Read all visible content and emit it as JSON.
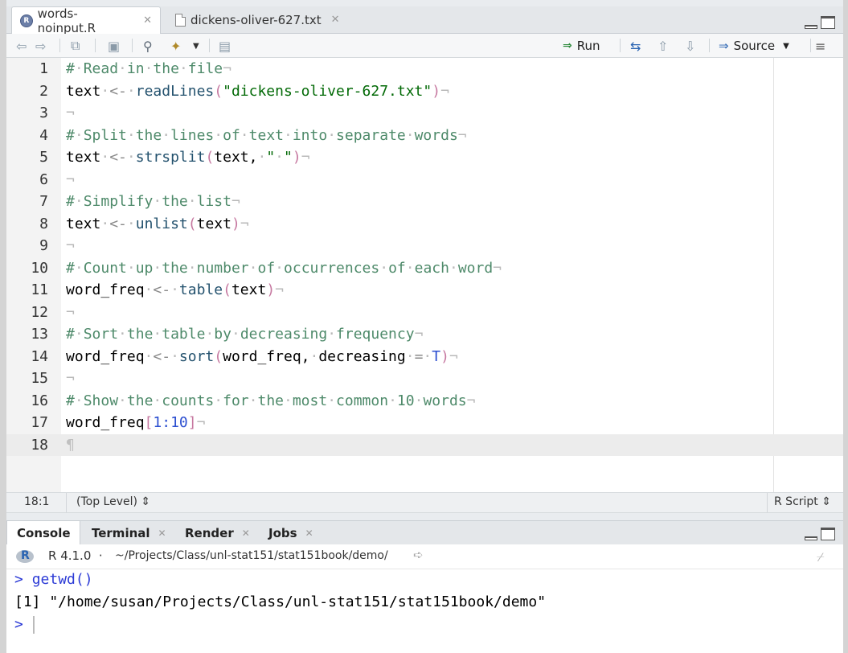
{
  "editor_tabs": [
    {
      "label": "words-noinput.R",
      "icon": "r-file-icon",
      "active": true
    },
    {
      "label": "dickens-oliver-627.txt",
      "icon": "text-file-icon",
      "active": false
    }
  ],
  "toolbar": {
    "run_label": "Run",
    "source_label": "Source"
  },
  "code_lines": [
    {
      "n": "1"
    },
    {
      "n": "2"
    },
    {
      "n": "3"
    },
    {
      "n": "4"
    },
    {
      "n": "5"
    },
    {
      "n": "6"
    },
    {
      "n": "7"
    },
    {
      "n": "8"
    },
    {
      "n": "9"
    },
    {
      "n": "10"
    },
    {
      "n": "11"
    },
    {
      "n": "12"
    },
    {
      "n": "13"
    },
    {
      "n": "14"
    },
    {
      "n": "15"
    },
    {
      "n": "16"
    },
    {
      "n": "17"
    },
    {
      "n": "18"
    }
  ],
  "code": {
    "l1": "Read in the file",
    "l2_fn": "readLines",
    "l2_str": "\"dickens-oliver-627.txt\"",
    "l4": "Split the lines of text into separate words",
    "l5_fn": "strsplit",
    "l7": "Simplify the list",
    "l8_fn": "unlist",
    "l10": "Count up the number of occurrences of each word",
    "l11_fn": "table",
    "l13": "Sort the table by decreasing frequency",
    "l14_fn": "sort",
    "l16": "Show the counts for the most common 10 words",
    "l17_idx": "1:10"
  },
  "status": {
    "position": "18:1",
    "scope": "(Top Level)",
    "file_type": "R Script"
  },
  "console_tabs": [
    {
      "label": "Console",
      "active": true,
      "closable": false
    },
    {
      "label": "Terminal",
      "active": false,
      "closable": true
    },
    {
      "label": "Render",
      "active": false,
      "closable": true
    },
    {
      "label": "Jobs",
      "active": false,
      "closable": true
    }
  ],
  "console": {
    "r_version": "R 4.1.0",
    "separator": "·",
    "working_dir": "~/Projects/Class/unl-stat151/stat151book/demo/",
    "cmd1": "getwd()",
    "out1": "[1] \"/home/susan/Projects/Class/unl-stat151/stat151book/demo\"",
    "prompt": ">"
  }
}
